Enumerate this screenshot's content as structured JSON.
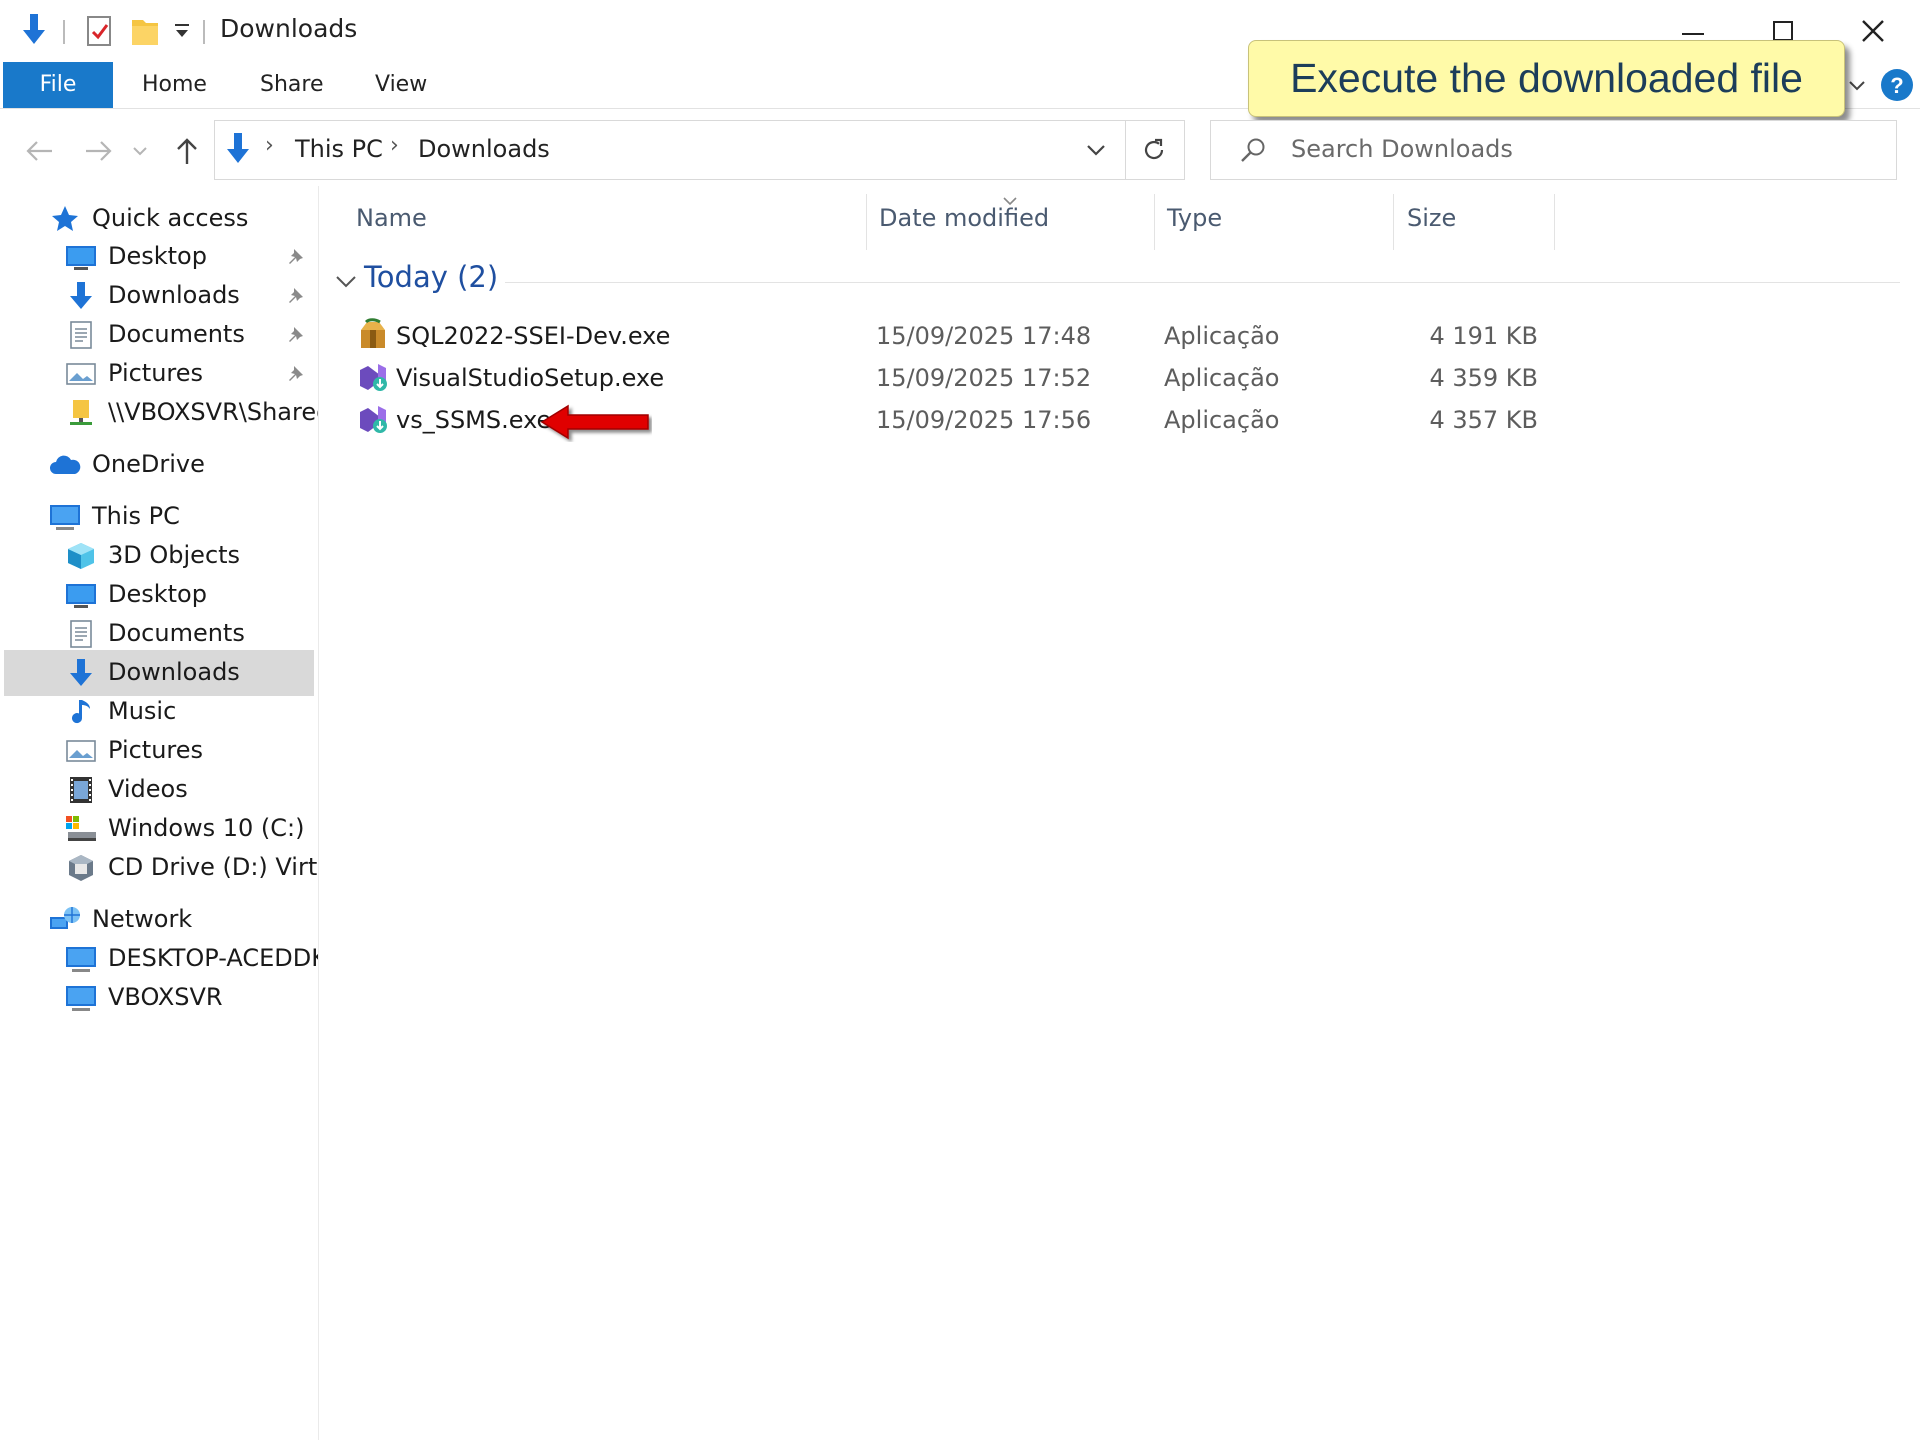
{
  "window": {
    "title": "Downloads",
    "quick_access_toolbar": [
      "down-arrow-icon",
      "properties-icon",
      "new-folder-icon",
      "customize-dropdown-icon"
    ],
    "controls": [
      "minimize-icon",
      "maximize-icon",
      "close-icon"
    ]
  },
  "ribbon": {
    "tabs": [
      "File",
      "Home",
      "Share",
      "View"
    ],
    "help_icon": "help-icon"
  },
  "callout": {
    "text": "Execute the downloaded file"
  },
  "address_bar": {
    "breadcrumbs": [
      "This PC",
      "Downloads"
    ],
    "search_placeholder": "Search Downloads"
  },
  "nav_pane": {
    "items": [
      {
        "label": "Quick access",
        "icon": "star-icon",
        "level": 0
      },
      {
        "label": "Desktop",
        "icon": "desktop-icon",
        "level": 1,
        "pinned": true
      },
      {
        "label": "Downloads",
        "icon": "downloads-icon",
        "level": 1,
        "pinned": true
      },
      {
        "label": "Documents",
        "icon": "documents-icon",
        "level": 1,
        "pinned": true
      },
      {
        "label": "Pictures",
        "icon": "pictures-icon",
        "level": 1,
        "pinned": true
      },
      {
        "label": "\\\\VBOXSVR\\Shared_",
        "icon": "network-drive-icon",
        "level": 1
      },
      {
        "label": "OneDrive",
        "icon": "cloud-icon",
        "level": 0
      },
      {
        "label": "This PC",
        "icon": "computer-icon",
        "level": 0
      },
      {
        "label": "3D Objects",
        "icon": "cube-icon",
        "level": 1
      },
      {
        "label": "Desktop",
        "icon": "desktop-icon",
        "level": 1
      },
      {
        "label": "Documents",
        "icon": "documents-icon",
        "level": 1
      },
      {
        "label": "Downloads",
        "icon": "downloads-icon",
        "level": 1,
        "selected": true
      },
      {
        "label": "Music",
        "icon": "music-icon",
        "level": 1
      },
      {
        "label": "Pictures",
        "icon": "pictures-icon",
        "level": 1
      },
      {
        "label": "Videos",
        "icon": "videos-icon",
        "level": 1
      },
      {
        "label": "Windows 10 (C:)",
        "icon": "drive-icon",
        "level": 1
      },
      {
        "label": "CD Drive (D:) Virtua",
        "icon": "cd-drive-icon",
        "level": 1
      },
      {
        "label": "Network",
        "icon": "network-icon",
        "level": 0
      },
      {
        "label": "DESKTOP-ACEDDKF",
        "icon": "computer-icon",
        "level": 1
      },
      {
        "label": "VBOXSVR",
        "icon": "computer-icon",
        "level": 1
      }
    ]
  },
  "file_list": {
    "columns": [
      "Name",
      "Date modified",
      "Type",
      "Size"
    ],
    "group": "Today (2)",
    "rows": [
      {
        "name": "SQL2022-SSEI-Dev.exe",
        "date": "15/09/2025 17:48",
        "type": "Aplicação",
        "size": "4 191 KB",
        "icon": "sql-installer-icon"
      },
      {
        "name": "VisualStudioSetup.exe",
        "date": "15/09/2025 17:52",
        "type": "Aplicação",
        "size": "4 359 KB",
        "icon": "visual-studio-icon"
      },
      {
        "name": "vs_SSMS.exe",
        "date": "15/09/2025 17:56",
        "type": "Aplicação",
        "size": "4 357 KB",
        "icon": "visual-studio-icon"
      }
    ]
  },
  "annotation_arrow": {
    "color": "#e00000",
    "icon": "red-arrow-icon"
  }
}
